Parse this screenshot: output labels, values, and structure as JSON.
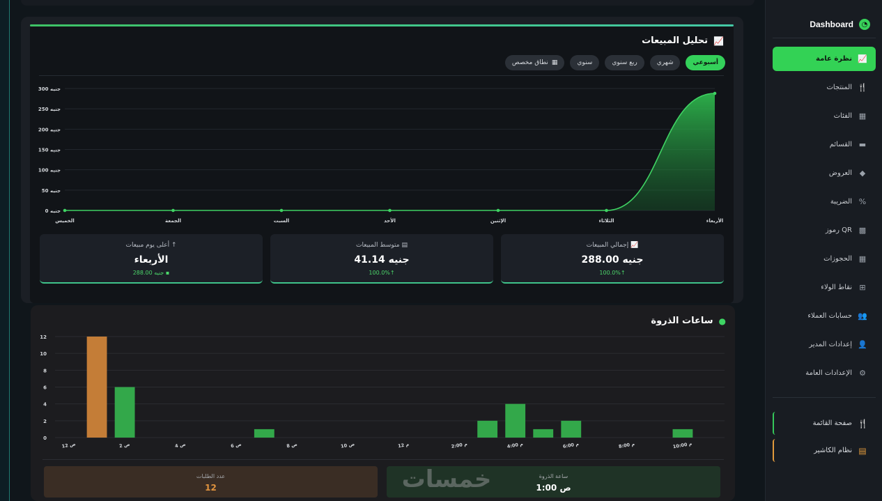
{
  "sidebar": {
    "brand": "Dashboard",
    "items": [
      {
        "label": "نظرة عامة",
        "icon": "chart-line-icon",
        "glyph": "📈"
      },
      {
        "label": "المنتجات",
        "icon": "utensils-icon",
        "glyph": "🍴"
      },
      {
        "label": "الفئات",
        "icon": "grid-icon",
        "glyph": "▦"
      },
      {
        "label": "القسائم",
        "icon": "ticket-icon",
        "glyph": "▬"
      },
      {
        "label": "العروض",
        "icon": "tag-icon",
        "glyph": "◆"
      },
      {
        "label": "الضريبة",
        "icon": "percent-icon",
        "glyph": "%"
      },
      {
        "label": "رموز QR",
        "icon": "qrcode-icon",
        "glyph": "▩"
      },
      {
        "label": "الحجوزات",
        "icon": "calendar-icon",
        "glyph": "▦"
      },
      {
        "label": "نقاط الولاء",
        "icon": "gift-icon",
        "glyph": "⊞"
      },
      {
        "label": "حسابات العملاء",
        "icon": "users-icon",
        "glyph": "👥"
      },
      {
        "label": "إعدادات المدير",
        "icon": "user-cog-icon",
        "glyph": "👤"
      },
      {
        "label": "الإعدادات العامة",
        "icon": "gear-icon",
        "glyph": "⚙"
      }
    ],
    "menu_page": {
      "label": "صفحة القائمة",
      "icon": "utensils-icon",
      "glyph": "🍴"
    },
    "cashier": {
      "label": "نظام الكاشير",
      "icon": "cash-register-icon",
      "glyph": "▤"
    }
  },
  "sales": {
    "title": "تحليل المبيعات",
    "periods": [
      {
        "label": "أسبوعي",
        "active": true
      },
      {
        "label": "شهري",
        "active": false
      },
      {
        "label": "ربع سنوي",
        "active": false
      },
      {
        "label": "سنوي",
        "active": false
      },
      {
        "label": "نطاق مخصص",
        "active": false,
        "icon": "calendar-icon"
      }
    ],
    "stats": [
      {
        "label": "إجمالي المبيعات",
        "value": "288.00 جنيه",
        "sub": "100.0%↑",
        "icon": "chart-line-icon"
      },
      {
        "label": "متوسط المبيعات",
        "value": "41.14 جنيه",
        "sub": "100.0%↑",
        "icon": "calculator-icon"
      },
      {
        "label": "أعلى يوم مبيعات",
        "value": "الأربعاء",
        "sub": "288.00 جنيه",
        "icon": "arrow-up-icon"
      }
    ]
  },
  "peak": {
    "title": "ساعات الذروة",
    "orders_label": "عدد الطلبات",
    "orders_value": "12",
    "hour_label": "ساعة الذروة",
    "hour_value": "1:00 ص",
    "watermark": "خمسات"
  },
  "chart_data": [
    {
      "type": "area",
      "categories": [
        "الخميس",
        "الجمعة",
        "السبت",
        "الأحد",
        "الإثنين",
        "الثلاثاء",
        "الأربعاء"
      ],
      "values": [
        0,
        0,
        0,
        0,
        0,
        0,
        288
      ],
      "ylim": [
        0,
        300
      ],
      "y_ticks": [
        "0 جنيه",
        "50 جنيه",
        "100 جنيه",
        "150 جنيه",
        "200 جنيه",
        "250 جنيه",
        "300 جنيه"
      ],
      "y_tick_values": [
        0,
        50,
        100,
        150,
        200,
        250,
        300
      ],
      "grid": true,
      "color": "#2fbd4f"
    },
    {
      "type": "bar",
      "categories": [
        "12 ص",
        "1 ص",
        "2 ص",
        "3 ص",
        "4 ص",
        "5 ص",
        "6 ص",
        "7 ص",
        "8 ص",
        "9 ص",
        "10 ص",
        "11 ص",
        "12 م",
        "1 م",
        "2:00 م",
        "3 م",
        "4:00 م",
        "5 م",
        "6:00 م",
        "7 م",
        "8:00 م",
        "9 م",
        "10:00 م",
        "11 م"
      ],
      "values": [
        0,
        12,
        6,
        0,
        0,
        0,
        0,
        1,
        0,
        0,
        0,
        0,
        0,
        0,
        0,
        2,
        4,
        1,
        2,
        0,
        0,
        0,
        1,
        0
      ],
      "x_tick_labels": [
        "12 ص",
        "2 ص",
        "4 ص",
        "6 ص",
        "8 ص",
        "10 ص",
        "12 م",
        "2:00 م",
        "4:00 م",
        "6:00 م",
        "8:00 م",
        "10:00 م"
      ],
      "ylim": [
        0,
        12
      ],
      "y_ticks": [
        0,
        2,
        4,
        6,
        8,
        10,
        12
      ],
      "highlight_index": 1,
      "colors": {
        "bar": "#33a84a",
        "highlight": "#c47d37"
      },
      "grid": true
    }
  ]
}
